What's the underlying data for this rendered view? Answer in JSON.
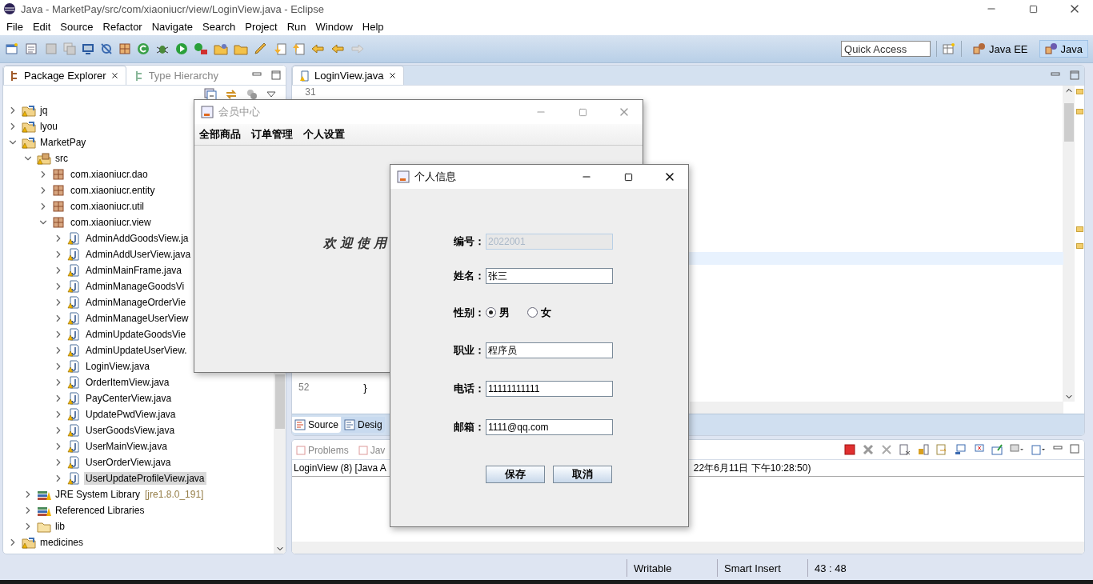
{
  "window": {
    "title": "Java - MarketPay/src/com/xiaoniucr/view/LoginView.java - Eclipse"
  },
  "menu": [
    "File",
    "Edit",
    "Source",
    "Refactor",
    "Navigate",
    "Search",
    "Project",
    "Run",
    "Window",
    "Help"
  ],
  "quick_access": {
    "placeholder": "Quick Access"
  },
  "perspectives": [
    {
      "label": "Java EE",
      "selected": false
    },
    {
      "label": "Java",
      "selected": true
    }
  ],
  "left_panel": {
    "tabs": [
      {
        "label": "Package Explorer",
        "selected": true
      },
      {
        "label": "Type Hierarchy",
        "selected": false
      }
    ],
    "tree": [
      {
        "kind": "project",
        "label": "jq",
        "expanded": false,
        "selected": false
      },
      {
        "kind": "project",
        "label": "lyou",
        "expanded": false,
        "selected": false
      },
      {
        "kind": "project",
        "label": "MarketPay",
        "expanded": true,
        "selected": false,
        "children": [
          {
            "kind": "source",
            "label": "src",
            "expanded": true,
            "selected": false,
            "children": [
              {
                "kind": "package",
                "label": "com.xiaoniucr.dao",
                "expanded": false,
                "selected": false
              },
              {
                "kind": "package",
                "label": "com.xiaoniucr.entity",
                "expanded": false,
                "selected": false
              },
              {
                "kind": "package",
                "label": "com.xiaoniucr.util",
                "expanded": false,
                "selected": false
              },
              {
                "kind": "package",
                "label": "com.xiaoniucr.view",
                "expanded": true,
                "selected": false,
                "children": [
                  {
                    "kind": "file",
                    "label": "AdminAddGoodsView.ja",
                    "expanded": false,
                    "selected": false
                  },
                  {
                    "kind": "file",
                    "label": "AdminAddUserView.java",
                    "expanded": false,
                    "selected": false
                  },
                  {
                    "kind": "file",
                    "label": "AdminMainFrame.java",
                    "expanded": false,
                    "selected": false
                  },
                  {
                    "kind": "file",
                    "label": "AdminManageGoodsVi",
                    "expanded": false,
                    "selected": false
                  },
                  {
                    "kind": "file",
                    "label": "AdminManageOrderVie",
                    "expanded": false,
                    "selected": false
                  },
                  {
                    "kind": "file",
                    "label": "AdminManageUserView",
                    "expanded": false,
                    "selected": false
                  },
                  {
                    "kind": "file",
                    "label": "AdminUpdateGoodsVie",
                    "expanded": false,
                    "selected": false
                  },
                  {
                    "kind": "file",
                    "label": "AdminUpdateUserView.",
                    "expanded": false,
                    "selected": false
                  },
                  {
                    "kind": "file",
                    "label": "LoginView.java",
                    "expanded": false,
                    "selected": false
                  },
                  {
                    "kind": "file",
                    "label": "OrderItemView.java",
                    "expanded": false,
                    "selected": false
                  },
                  {
                    "kind": "file",
                    "label": "PayCenterView.java",
                    "expanded": false,
                    "selected": false
                  },
                  {
                    "kind": "file",
                    "label": "UpdatePwdView.java",
                    "expanded": false,
                    "selected": false
                  },
                  {
                    "kind": "file",
                    "label": "UserGoodsView.java",
                    "expanded": false,
                    "selected": false
                  },
                  {
                    "kind": "file",
                    "label": "UserMainView.java",
                    "expanded": false,
                    "selected": false
                  },
                  {
                    "kind": "file",
                    "label": "UserOrderView.java",
                    "expanded": false,
                    "selected": false
                  },
                  {
                    "kind": "file",
                    "label": "UserUpdateProfileView.java",
                    "expanded": false,
                    "selected": true
                  }
                ]
              }
            ]
          },
          {
            "kind": "library",
            "label": "JRE System Library",
            "note": "[jre1.8.0_191]",
            "expanded": false,
            "selected": false
          },
          {
            "kind": "library",
            "label": "Referenced Libraries",
            "expanded": false,
            "selected": false
          },
          {
            "kind": "folder",
            "label": "lib",
            "expanded": false,
            "selected": false
          }
        ]
      },
      {
        "kind": "project",
        "label": "medicines",
        "expanded": false,
        "selected": false
      }
    ]
  },
  "editor": {
    "tabs": [
      {
        "label": "LoginView.java",
        "selected": true
      }
    ],
    "lines": [
      {
        "number": "31"
      },
      {
        "number": "52",
        "code": "}"
      }
    ],
    "bottom_tabs": [
      {
        "label": "Source",
        "selected": true
      },
      {
        "label": "Desig",
        "selected": false
      }
    ]
  },
  "bottom_panel": {
    "tabs": [
      {
        "label": "Problems",
        "selected": false
      },
      {
        "label": "Jav",
        "selected": false
      }
    ],
    "console_title": "LoginView (8) [Java A",
    "console_time": "22年6月11日 下午10:28:50)"
  },
  "status_bar": [
    "Writable",
    "Smart Insert",
    "43 : 48"
  ],
  "member_window": {
    "title": "会员中心",
    "menu": [
      "全部商品",
      "订单管理",
      "个人设置"
    ],
    "welcome": "欢迎使用"
  },
  "profile_dialog": {
    "title": "个人信息",
    "fields": [
      {
        "kind": "text",
        "label": "编号：",
        "value": "2022001",
        "disabled": true
      },
      {
        "kind": "text",
        "label": "姓名：",
        "value": "张三",
        "disabled": false
      },
      {
        "kind": "radio",
        "label": "性别：",
        "options": [
          {
            "label": "男",
            "selected": true
          },
          {
            "label": "女",
            "selected": false
          }
        ]
      },
      {
        "kind": "text",
        "label": "职业：",
        "value": "程序员",
        "disabled": false
      },
      {
        "kind": "text",
        "label": "电话：",
        "value": "11111111111",
        "disabled": false
      },
      {
        "kind": "text",
        "label": "邮箱：",
        "value": "1111@qq.com",
        "disabled": false
      }
    ],
    "buttons": [
      "保存",
      "取消"
    ]
  }
}
